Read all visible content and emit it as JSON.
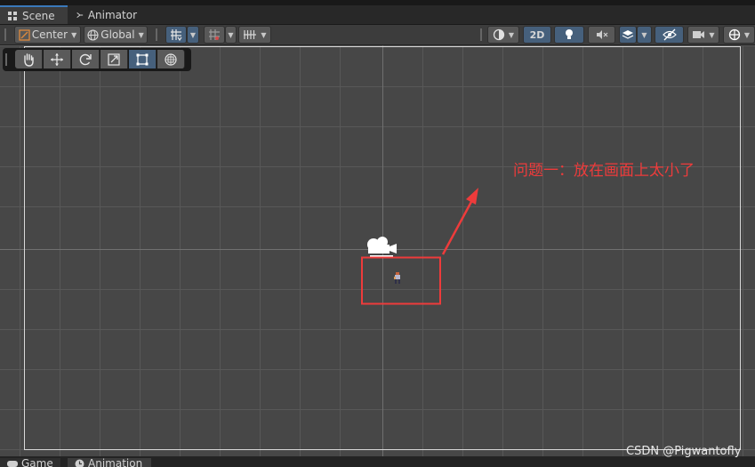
{
  "tabs": [
    {
      "label": "Scene",
      "icon": "scene-grid-icon"
    },
    {
      "label": "Animator",
      "icon": "animator-icon"
    }
  ],
  "toolbar": {
    "pivot_label": "Center",
    "space_label": "Global",
    "mode_2d_label": "2D"
  },
  "tools": [
    "hand-tool",
    "move-tool",
    "rotate-tool",
    "scale-tool",
    "rect-tool",
    "transform-tool"
  ],
  "active_tool": "rect-tool",
  "annotation": {
    "text": "问题一：放在画面上太小了",
    "color": "#ee3b3b"
  },
  "watermark": "CSDN @Pigwantofly",
  "bottom_tabs": [
    {
      "label": "Game",
      "icon": "gamepad-icon"
    },
    {
      "label": "Animation",
      "icon": "clock-icon"
    }
  ],
  "colors": {
    "accent": "#3a79bb",
    "active_button": "#46607c",
    "annotation_red": "#ee3b3b",
    "viewport_bg": "#474747"
  }
}
